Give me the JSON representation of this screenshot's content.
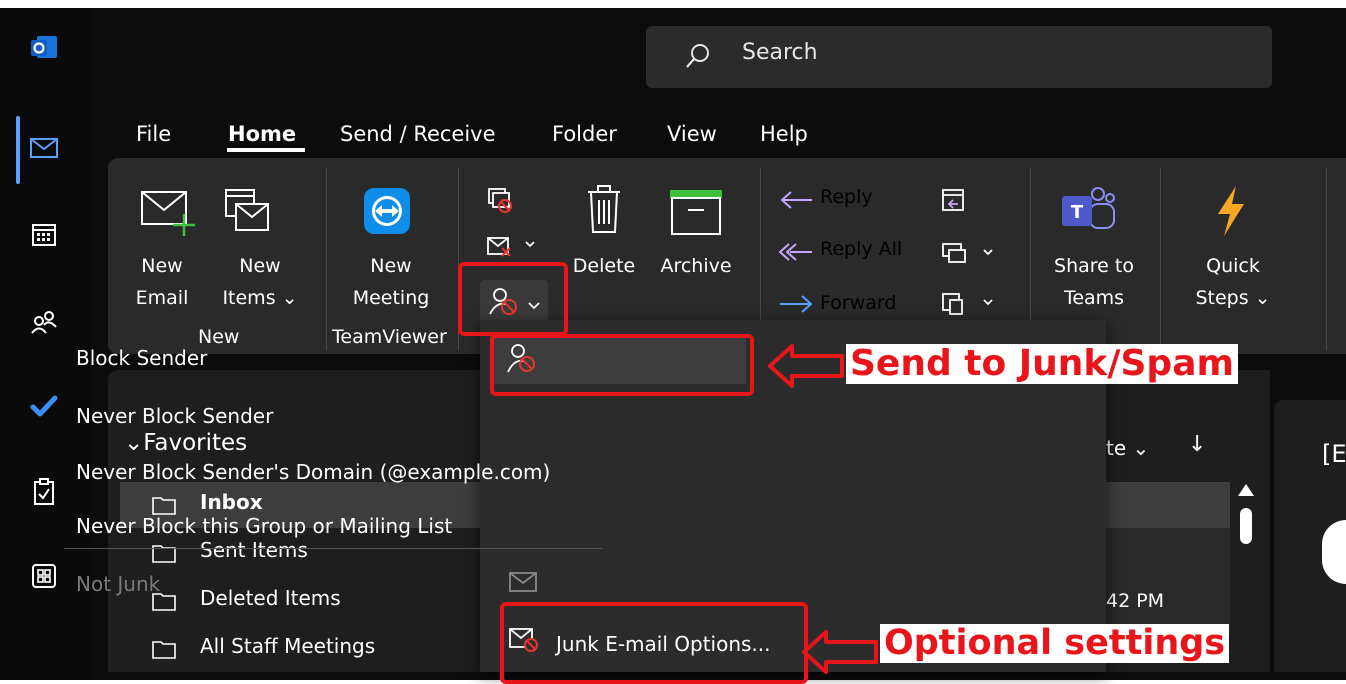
{
  "search": {
    "placeholder": "Search"
  },
  "tabs": [
    "File",
    "Home",
    "Send / Receive",
    "Folder",
    "View",
    "Help"
  ],
  "ribbon": {
    "new_email": [
      "New",
      "Email"
    ],
    "new_items": [
      "New",
      "Items ⌄"
    ],
    "new_meeting": [
      "New",
      "Meeting"
    ],
    "delete": "Delete",
    "archive": "Archive",
    "reply": "Reply",
    "reply_all": "Reply All",
    "forward": "Forward",
    "share_teams": [
      "Share to",
      "Teams"
    ],
    "quick_steps": [
      "Quick",
      "Steps ⌄"
    ],
    "group_new": "New",
    "group_teamviewer": "TeamViewer"
  },
  "nav": {
    "favorites": "⌄Favorites",
    "folders": [
      "Inbox",
      "Sent Items",
      "Deleted Items",
      "All Staff Meetings"
    ]
  },
  "list": {
    "sort": "te ⌄",
    "arrow": "↓",
    "time": "42 PM",
    "reading_char": "[E"
  },
  "menu": {
    "block_sender": "Block Sender",
    "never_block_sender": "Never Block Sender",
    "never_block_domain": "Never Block Sender's Domain (@example.com)",
    "never_block_group": "Never Block this Group or Mailing List",
    "not_junk": "Not Junk",
    "junk_options": "Junk E-mail Options..."
  },
  "annotations": {
    "send_to_junk": "Send to Junk/Spam",
    "optional_settings": "Optional settings"
  },
  "colors": {
    "accent": "#5aa0ff",
    "annotation": "#e8151b",
    "ribbon": "#2a2a2a"
  }
}
